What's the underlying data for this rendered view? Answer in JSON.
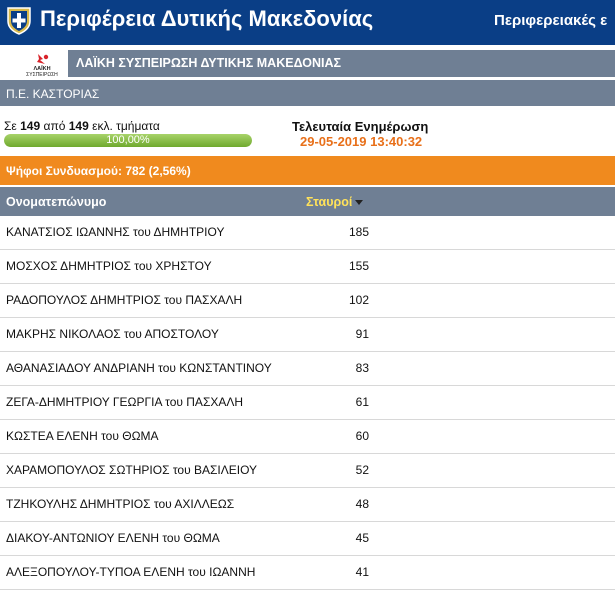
{
  "header": {
    "site_title": "Περιφέρεια Δυτικής Μακεδονίας",
    "elections_link": "Περιφερειακές ε",
    "emblem_icon": "greek-cross-emblem-icon",
    "bar_color": "#0a3e86"
  },
  "party": {
    "name": "ΛΑΪΚΗ ΣΥΣΠΕΙΡΩΣΗ ΔΥΤΙΚΗΣ ΜΑΚΕΔΟΝΙΑΣ",
    "logo_icon": "party-logo-icon",
    "logo_text": "ΛΑΪΚΗ ΣΥΣΠΕΙΡΩΣΗ"
  },
  "unit": {
    "name": "Π.Ε. ΚΑΣΤΟΡΙΑΣ"
  },
  "status": {
    "sections_prefix": "Σε",
    "sections_counted": "149",
    "sections_mid": "από",
    "sections_total": "149",
    "sections_suffix": "εκλ. τμήματα",
    "progress_fraction": 1.0,
    "progress_label": "100,00%",
    "update_label": "Τελευταία Ενημέρωση",
    "update_time": "29-05-2019 13:40:32",
    "accent_color": "#e8701a"
  },
  "votes": {
    "label": "Ψήφοι Συνδυασμού: 782 (2,56%)",
    "bar_color": "#f08a1e"
  },
  "table": {
    "col_name": "Ονοματεπώνυμο",
    "col_votes": "Σταυροί",
    "rows": [
      {
        "name": "ΚΑΝΑΤΣΙΟΣ ΙΩΑΝΝΗΣ του ΔΗΜΗΤΡΙΟΥ",
        "votes": "185"
      },
      {
        "name": "ΜΟΣΧΟΣ ΔΗΜΗΤΡΙΟΣ του ΧΡΗΣΤΟΥ",
        "votes": "155"
      },
      {
        "name": "ΡΑΔΟΠΟΥΛΟΣ ΔΗΜΗΤΡΙΟΣ του ΠΑΣΧΑΛΗ",
        "votes": "102"
      },
      {
        "name": "ΜΑΚΡΗΣ ΝΙΚΟΛΑΟΣ του ΑΠΟΣΤΟΛΟΥ",
        "votes": "91"
      },
      {
        "name": "ΑΘΑΝΑΣΙΑΔΟΥ ΑΝΔΡΙΑΝΗ του ΚΩΝΣΤΑΝΤΙΝΟΥ",
        "votes": "83"
      },
      {
        "name": "ΖΕΓΑ-ΔΗΜΗΤΡΙΟΥ ΓΕΩΡΓΙΑ του ΠΑΣΧΑΛΗ",
        "votes": "61"
      },
      {
        "name": "ΚΩΣΤΕΑ ΕΛΕΝΗ του ΘΩΜΑ",
        "votes": "60"
      },
      {
        "name": "ΧΑΡΑΜΟΠΟΥΛΟΣ ΣΩΤΗΡΙΟΣ του ΒΑΣΙΛΕΙΟΥ",
        "votes": "52"
      },
      {
        "name": "ΤΖΗΚΟΥΛΗΣ ΔΗΜΗΤΡΙΟΣ του ΑΧΙΛΛΕΩΣ",
        "votes": "48"
      },
      {
        "name": "ΔΙΑΚΟΥ-ΑΝΤΩΝΙΟΥ ΕΛΕΝΗ του ΘΩΜΑ",
        "votes": "45"
      },
      {
        "name": "ΑΛΕΞΟΠΟΥΛΟΥ-ΤΥΠΟΑ ΕΛΕΝΗ του ΙΩΑΝΝΗ",
        "votes": "41"
      }
    ]
  }
}
